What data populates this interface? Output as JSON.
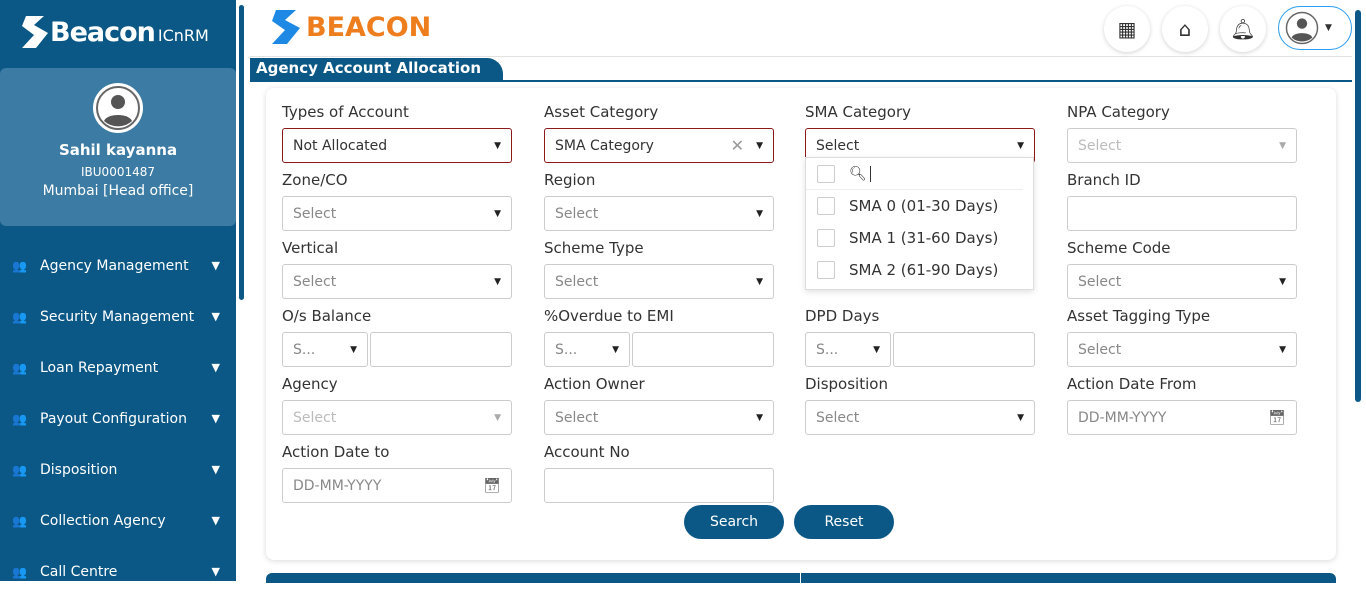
{
  "sidebar": {
    "logo_main": "Beacon",
    "logo_sub": "ICnRM",
    "user": {
      "name": "Sahil kayanna",
      "id": "IBU0001487",
      "location": "Mumbai [Head office]"
    },
    "items": [
      {
        "label": "Agency Management"
      },
      {
        "label": "Security Management"
      },
      {
        "label": "Loan Repayment"
      },
      {
        "label": "Payout Configuration"
      },
      {
        "label": "Disposition"
      },
      {
        "label": "Collection Agency"
      },
      {
        "label": "Call Centre"
      }
    ]
  },
  "header": {
    "brand": "BEACON",
    "icons": [
      "dashboard-icon",
      "home-icon",
      "bell-icon",
      "user-avatar-icon"
    ]
  },
  "page": {
    "title": "Agency Account Allocation"
  },
  "form": {
    "types_of_account": {
      "label": "Types of Account",
      "value": "Not Allocated"
    },
    "asset_category": {
      "label": "Asset Category",
      "value": "SMA Category"
    },
    "sma_category": {
      "label": "SMA Category",
      "value": "Select",
      "options": [
        "SMA 0 (01-30 Days)",
        "SMA 1 (31-60 Days)",
        "SMA 2 (61-90 Days)"
      ]
    },
    "npa_category": {
      "label": "NPA Category",
      "value": "Select"
    },
    "zone": {
      "label": "Zone/CO",
      "value": "Select"
    },
    "region": {
      "label": "Region",
      "value": "Select"
    },
    "branch_id": {
      "label": "Branch ID",
      "value": ""
    },
    "vertical": {
      "label": "Vertical",
      "value": "Select"
    },
    "scheme_type": {
      "label": "Scheme Type",
      "value": "Select"
    },
    "scheme_code": {
      "label": "Scheme Code",
      "value": "Select"
    },
    "os_balance": {
      "label": "O/s Balance",
      "op": "S...",
      "value": ""
    },
    "overdue_emi": {
      "label": "%Overdue to EMI",
      "op": "S...",
      "value": ""
    },
    "dpd_days": {
      "label": "DPD Days",
      "op": "S...",
      "value": ""
    },
    "asset_tagging": {
      "label": "Asset Tagging Type",
      "value": "Select"
    },
    "agency": {
      "label": "Agency",
      "value": "Select"
    },
    "action_owner": {
      "label": "Action Owner",
      "value": "Select"
    },
    "disposition": {
      "label": "Disposition",
      "value": "Select"
    },
    "action_date_from": {
      "label": "Action Date From",
      "placeholder": "DD-MM-YYYY"
    },
    "action_date_to": {
      "label": "Action Date to",
      "placeholder": "DD-MM-YYYY"
    },
    "account_no": {
      "label": "Account No",
      "value": ""
    },
    "search_label": "Search",
    "reset_label": "Reset"
  },
  "colors": {
    "primary": "#0b5886",
    "brand_orange": "#ee7d1d",
    "error_border": "#8b1a1a"
  }
}
